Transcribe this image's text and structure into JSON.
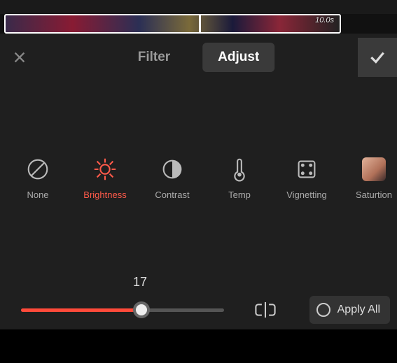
{
  "timeline": {
    "duration_label": "10.0s"
  },
  "header": {
    "tabs": [
      {
        "label": "Filter",
        "active": false
      },
      {
        "label": "Adjust",
        "active": true
      }
    ]
  },
  "adjust": {
    "items": [
      {
        "key": "none",
        "label": "None",
        "selected": false
      },
      {
        "key": "brightness",
        "label": "Brightness",
        "selected": true
      },
      {
        "key": "contrast",
        "label": "Contrast",
        "selected": false
      },
      {
        "key": "temp",
        "label": "Temp",
        "selected": false
      },
      {
        "key": "vignetting",
        "label": "Vignetting",
        "selected": false
      },
      {
        "key": "saturation",
        "label": "Saturtion",
        "selected": false
      }
    ],
    "slider": {
      "value": 17,
      "min": -50,
      "max": 50
    },
    "apply_all_label": "Apply All"
  },
  "colors": {
    "accent": "#ff4a3a",
    "panel": "#1f1f1f"
  }
}
